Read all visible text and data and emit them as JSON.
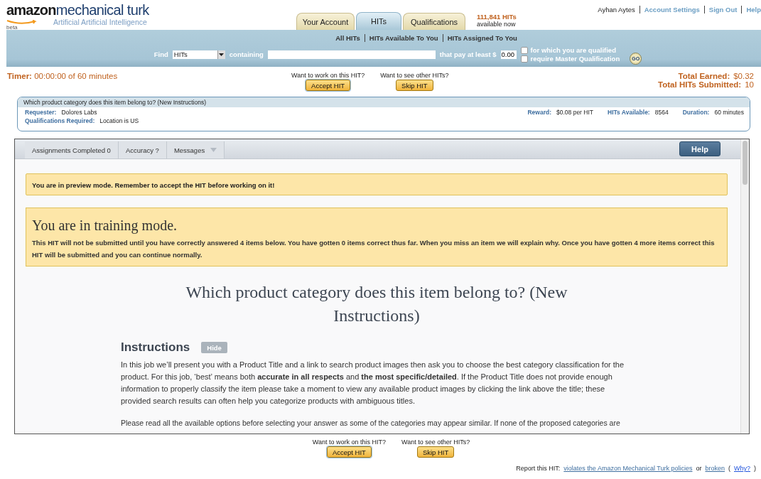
{
  "logo": {
    "brand": "amazon",
    "product": "mechanical turk",
    "tagline": "Artificial Artificial Intelligence",
    "badge": "beta"
  },
  "tabs": [
    {
      "label": "Your Account",
      "selected": false
    },
    {
      "label": "HITs",
      "selected": true
    },
    {
      "label": "Qualifications",
      "selected": false
    }
  ],
  "hits_available": {
    "count": "111,841 HITs",
    "note": "available now"
  },
  "user_links": {
    "user": "Ayhan Aytes",
    "links": [
      "Account Settings",
      "Sign Out",
      "Help"
    ]
  },
  "subnav": [
    "All HITs",
    "HITs Available To You",
    "HITs Assigned To You"
  ],
  "search": {
    "find_label": "Find",
    "find_value": "HITs",
    "containing_label": "containing",
    "pay_label": "that pay at least $",
    "pay_value": "0.00",
    "filters": [
      {
        "label": "for which you are qualified",
        "checked": false
      },
      {
        "label": "require Master Qualification",
        "checked": false
      }
    ],
    "go": "GO"
  },
  "timer": {
    "label": "Timer:",
    "value": "00:00:00 of 60 minutes"
  },
  "top_actions": [
    {
      "prompt": "Want to work on this HIT?",
      "button": "Accept HIT",
      "selected": true
    },
    {
      "prompt": "Want to see other HITs?",
      "button": "Skip HIT",
      "selected": false
    }
  ],
  "totals": [
    {
      "label": "Total Earned:",
      "value": "$0.32"
    },
    {
      "label": "Total HITs Submitted:",
      "value": "10"
    }
  ],
  "hit_info": {
    "title": "Which product category does this item belong to? (New Instructions)",
    "requester_label": "Requester:",
    "requester": "Dolores Labs",
    "qualifications_label": "Qualifications Required:",
    "qualifications": "Location is US",
    "fields": [
      {
        "label": "Reward:",
        "value": "$0.08 per HIT"
      },
      {
        "label": "HITs Available:",
        "value": "8564"
      },
      {
        "label": "Duration:",
        "value": "60 minutes"
      }
    ]
  },
  "task": {
    "toolbar": [
      {
        "label": "Assignments Completed 0",
        "kind": "text"
      },
      {
        "label": "Accuracy ?",
        "kind": "text"
      },
      {
        "label": "Messages",
        "kind": "dropdown"
      }
    ],
    "help": "Help",
    "preview_notice": "You are in preview mode. Remember to accept the HIT before working on it!",
    "training": {
      "title": "You are in training mode.",
      "body": "This HIT will not be submitted until you have correctly answered 4 items below. You have gotten 0 items correct thus far. When you miss an item we will explain why. Once you have gotten 4 more items correct this HIT will be submitted and you can continue normally."
    },
    "heading": "Which product category does this item belong to? (New Instructions)",
    "instructions_title": "Instructions",
    "hide": "Hide",
    "paragraphs": [
      "In this job we’ll present you with a Product Title and a link to search product images then ask you to choose the best category classification for the product. For this job, ‘best’ means both **accurate in all respects** and **the most specific/detailed**. If the Product Title does not provide enough information to properly classify the item please take a moment to view any available product images by clicking the link above the title; these provided search results can often help you categorize products with ambiguous titles.",
      "Please read all the available options before selecting your answer as some of the categories may appear similar. If none of the proposed categories are"
    ]
  },
  "bottom_actions": [
    {
      "prompt": "Want to work on this HIT?",
      "button": "Accept HIT",
      "selected": true
    },
    {
      "prompt": "Want to see other HITs?",
      "button": "Skip HIT",
      "selected": false
    }
  ],
  "report": {
    "label": "Report this HIT:",
    "links": [
      {
        "text": "violates the Amazon Mechanical Turk policies",
        "kind": "link"
      },
      {
        "text": "or",
        "kind": "text"
      },
      {
        "text": "broken",
        "kind": "link"
      },
      {
        "text": "(",
        "kind": "text"
      },
      {
        "text": "Why?",
        "kind": "blue-link"
      },
      {
        "text": ")",
        "kind": "text"
      }
    ]
  }
}
